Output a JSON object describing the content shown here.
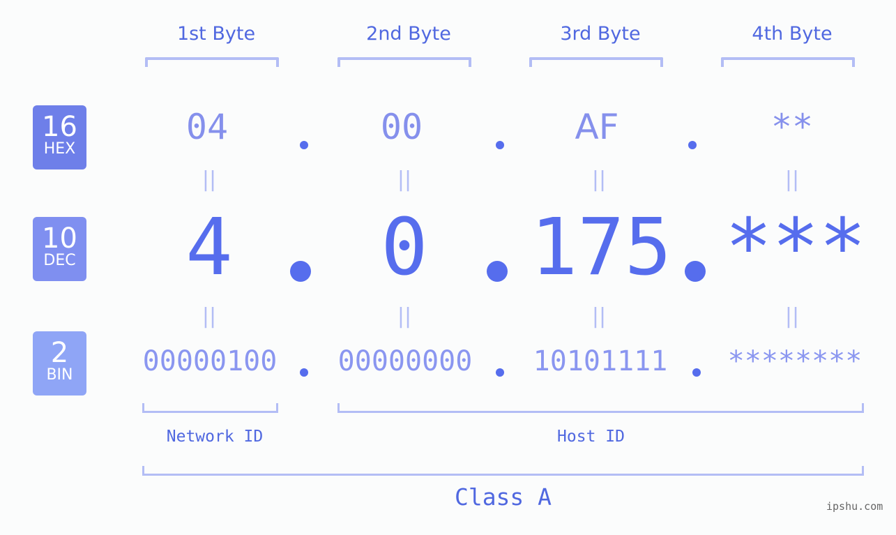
{
  "bytes": {
    "headers": [
      "1st Byte",
      "2nd Byte",
      "3rd Byte",
      "4th Byte"
    ]
  },
  "badges": {
    "hex": {
      "base": "16",
      "label": "HEX",
      "color": "#6e7fe9"
    },
    "dec": {
      "base": "10",
      "label": "DEC",
      "color": "#7f8ff0"
    },
    "bin": {
      "base": "2",
      "label": "BIN",
      "color": "#8fa5f6"
    }
  },
  "hex": [
    "04",
    "00",
    "AF",
    "**"
  ],
  "dec": [
    "4",
    "0",
    "175",
    "***"
  ],
  "bin": [
    "00000100",
    "00000000",
    "10101111",
    "********"
  ],
  "equals_symbol": "||",
  "separator": ".",
  "network_id_label": "Network ID",
  "host_id_label": "Host ID",
  "class_label": "Class A",
  "watermark": "ipshu.com",
  "colors": {
    "accent": "#566ded",
    "bracket": "#b3bdf5",
    "background": "#fbfcfc"
  }
}
